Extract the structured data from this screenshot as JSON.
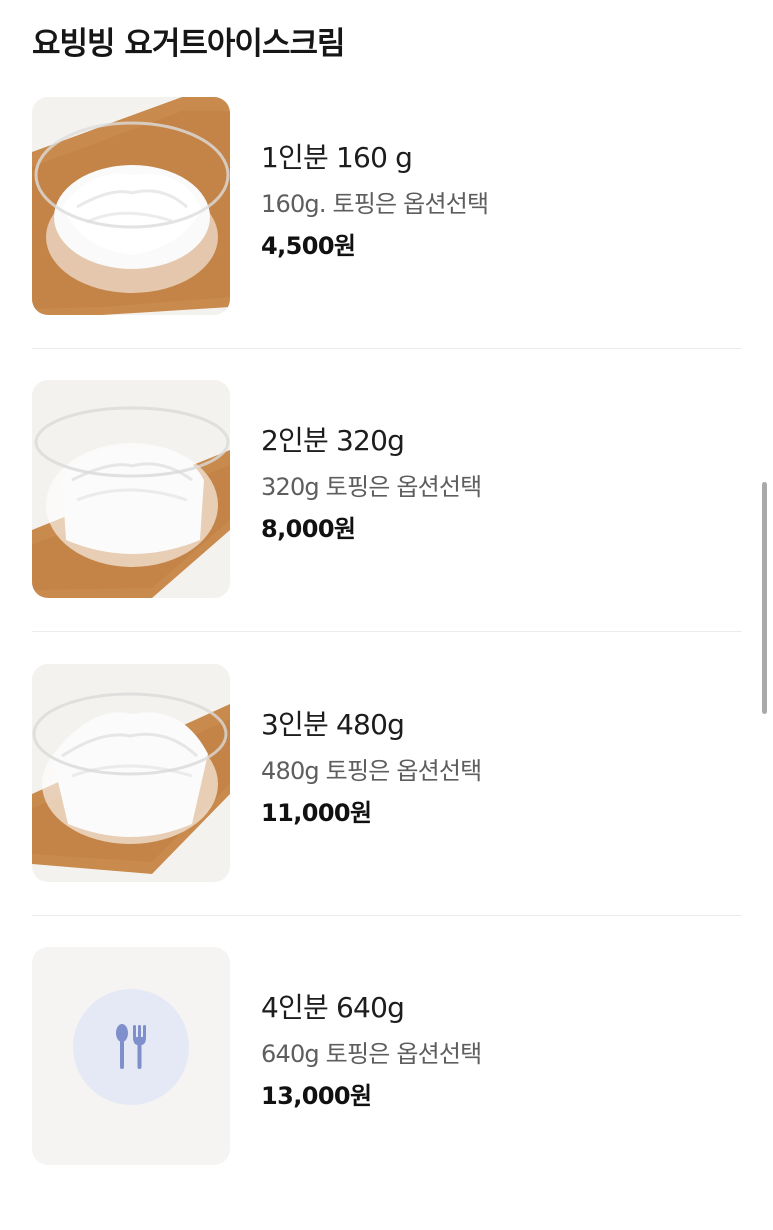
{
  "section": {
    "title": "요빙빙 요거트아이스크림"
  },
  "items": [
    {
      "name": "1인분 160 g",
      "description": "160g. 토핑은 옵션선택",
      "price": "4,500원",
      "image": "yogurt-ice-cream-photo"
    },
    {
      "name": "2인분 320g",
      "description": "320g 토핑은 옵션선택",
      "price": "8,000원",
      "image": "yogurt-ice-cream-photo"
    },
    {
      "name": "3인분 480g",
      "description": "480g 토핑은 옵션선택",
      "price": "11,000원",
      "image": "yogurt-ice-cream-photo"
    },
    {
      "name": "4인분 640g",
      "description": "640g 토핑은 옵션선택",
      "price": "13,000원",
      "image": "utensils-placeholder-icon"
    }
  ],
  "colors": {
    "placeholder_circle": "#e5e9f6",
    "placeholder_icon": "#7f8fcb",
    "board_wood": "#c98a4e",
    "divider": "#ececec"
  }
}
